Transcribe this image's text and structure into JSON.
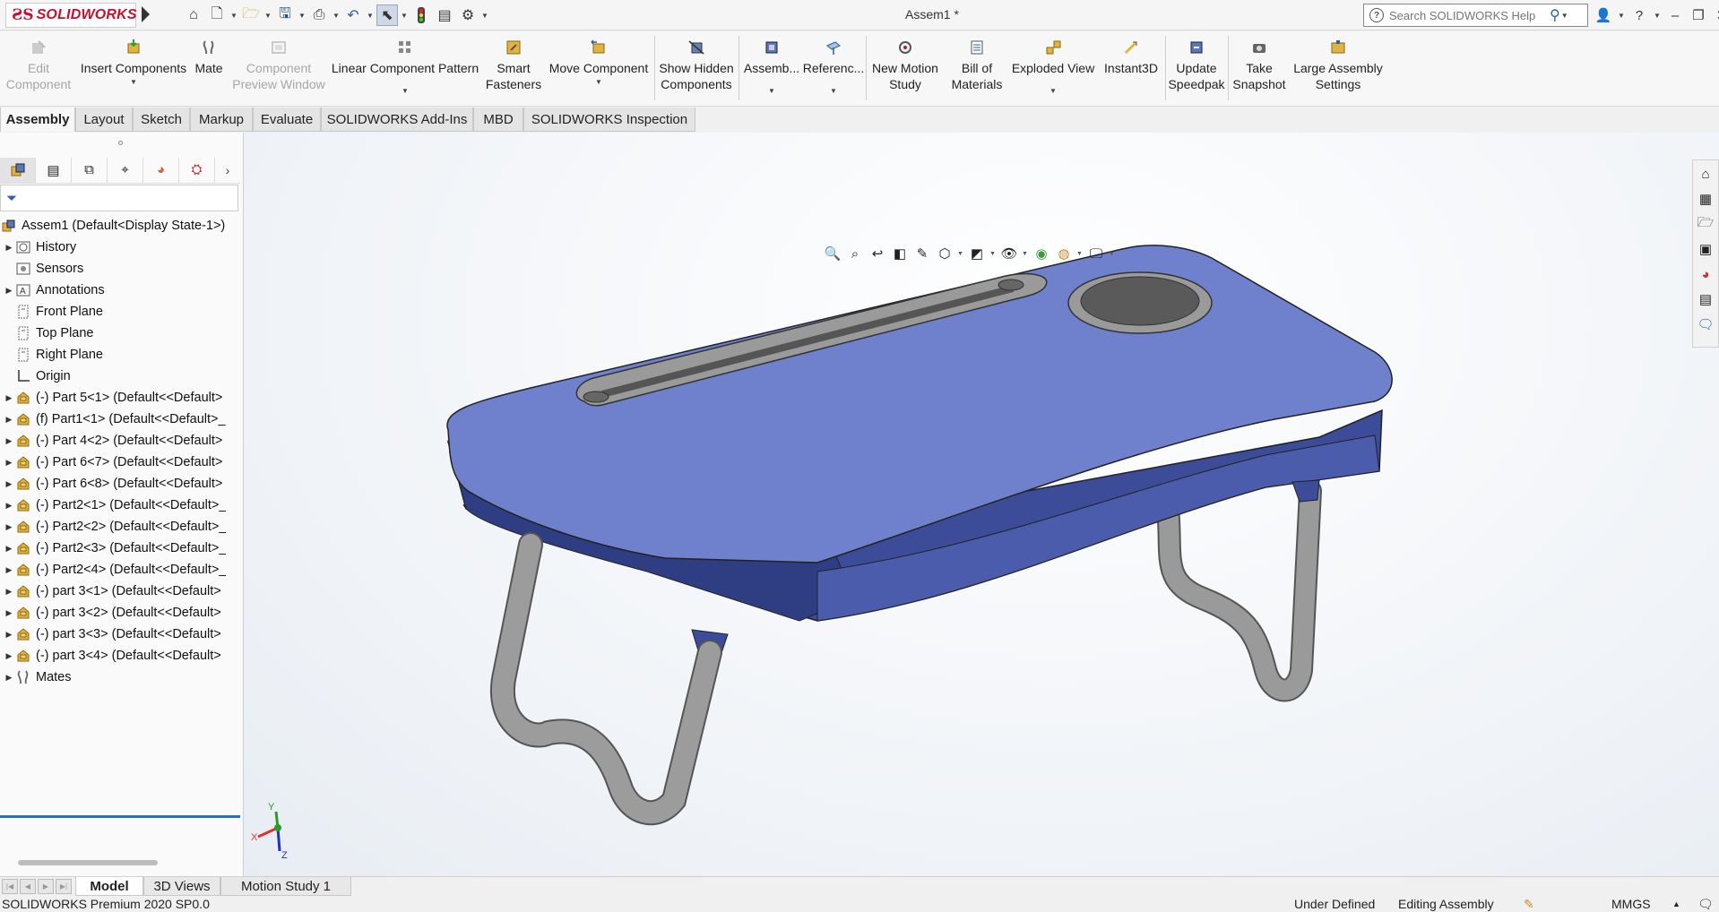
{
  "titlebar": {
    "app_logo_text": "SOLIDWORKS",
    "document_title": "Assem1 *",
    "search_placeholder": "Search SOLIDWORKS Help"
  },
  "commands": [
    {
      "label_1": "Edit",
      "label_2": "Component",
      "enabled": false,
      "icon": "edit-component-icon"
    },
    {
      "label_1": "Insert Components",
      "label_2": "",
      "enabled": true,
      "dropdown": true,
      "icon": "insert-components-icon"
    },
    {
      "label_1": "Mate",
      "label_2": "",
      "enabled": true,
      "icon": "mate-icon"
    },
    {
      "label_1": "Component",
      "label_2": "Preview Window",
      "enabled": false,
      "icon": "preview-window-icon"
    },
    {
      "label_1": "Linear Component Pattern",
      "label_2": "",
      "enabled": true,
      "dropdown": true,
      "icon": "linear-pattern-icon"
    },
    {
      "label_1": "Smart",
      "label_2": "Fasteners",
      "enabled": true,
      "icon": "smart-fasteners-icon"
    },
    {
      "label_1": "Move Component",
      "label_2": "",
      "enabled": true,
      "dropdown": true,
      "icon": "move-component-icon"
    },
    {
      "label_1": "Show Hidden",
      "label_2": "Components",
      "enabled": true,
      "icon": "show-hidden-icon"
    },
    {
      "label_1": "Assemb...",
      "label_2": "",
      "enabled": true,
      "dropdown": true,
      "icon": "assembly-features-icon"
    },
    {
      "label_1": "Referenc...",
      "label_2": "",
      "enabled": true,
      "dropdown": true,
      "icon": "reference-geometry-icon"
    },
    {
      "label_1": "New Motion",
      "label_2": "Study",
      "enabled": true,
      "icon": "motion-study-icon"
    },
    {
      "label_1": "Bill of",
      "label_2": "Materials",
      "enabled": true,
      "icon": "bom-icon"
    },
    {
      "label_1": "Exploded View",
      "label_2": "",
      "enabled": true,
      "dropdown": true,
      "icon": "exploded-view-icon"
    },
    {
      "label_1": "Instant3D",
      "label_2": "",
      "enabled": true,
      "icon": "instant3d-icon"
    },
    {
      "label_1": "Update",
      "label_2": "Speedpak",
      "enabled": true,
      "icon": "speedpak-icon"
    },
    {
      "label_1": "Take",
      "label_2": "Snapshot",
      "enabled": true,
      "icon": "snapshot-icon"
    },
    {
      "label_1": "Large Assembly",
      "label_2": "Settings",
      "enabled": true,
      "icon": "large-assembly-icon"
    }
  ],
  "tabs": [
    "Assembly",
    "Layout",
    "Sketch",
    "Markup",
    "Evaluate",
    "SOLIDWORKS Add-Ins",
    "MBD",
    "SOLIDWORKS Inspection"
  ],
  "active_tab": "Assembly",
  "tree": {
    "root": "Assem1  (Default<Display State-1>)",
    "items": [
      {
        "label": "History",
        "expandable": true,
        "icon": "history-icon"
      },
      {
        "label": "Sensors",
        "expandable": false,
        "icon": "sensors-icon"
      },
      {
        "label": "Annotations",
        "expandable": true,
        "icon": "annotations-icon"
      },
      {
        "label": "Front Plane",
        "expandable": false,
        "icon": "plane-icon"
      },
      {
        "label": "Top Plane",
        "expandable": false,
        "icon": "plane-icon"
      },
      {
        "label": "Right Plane",
        "expandable": false,
        "icon": "plane-icon"
      },
      {
        "label": "Origin",
        "expandable": false,
        "icon": "origin-icon"
      },
      {
        "label": "(-) Part 5<1> (Default<<Default>",
        "expandable": true,
        "icon": "part-icon"
      },
      {
        "label": "(f) Part1<1> (Default<<Default>_",
        "expandable": true,
        "icon": "part-icon"
      },
      {
        "label": "(-) Part 4<2> (Default<<Default>",
        "expandable": true,
        "icon": "part-icon"
      },
      {
        "label": "(-) Part 6<7> (Default<<Default>",
        "expandable": true,
        "icon": "part-icon"
      },
      {
        "label": "(-) Part 6<8> (Default<<Default>",
        "expandable": true,
        "icon": "part-icon"
      },
      {
        "label": "(-) Part2<1> (Default<<Default>_",
        "expandable": true,
        "icon": "part-icon"
      },
      {
        "label": "(-) Part2<2> (Default<<Default>_",
        "expandable": true,
        "icon": "part-icon"
      },
      {
        "label": "(-) Part2<3> (Default<<Default>_",
        "expandable": true,
        "icon": "part-icon"
      },
      {
        "label": "(-) Part2<4> (Default<<Default>_",
        "expandable": true,
        "icon": "part-icon"
      },
      {
        "label": "(-) part 3<1> (Default<<Default>",
        "expandable": true,
        "icon": "part-icon"
      },
      {
        "label": "(-) part 3<2> (Default<<Default>",
        "expandable": true,
        "icon": "part-icon"
      },
      {
        "label": "(-) part 3<3> (Default<<Default>",
        "expandable": true,
        "icon": "part-icon"
      },
      {
        "label": "(-) part 3<4> (Default<<Default>",
        "expandable": true,
        "icon": "part-icon"
      },
      {
        "label": "Mates",
        "expandable": true,
        "icon": "mates-icon"
      }
    ]
  },
  "triad": {
    "x": "X",
    "y": "Y",
    "z": "Z"
  },
  "bottom_tabs": [
    "Model",
    "3D Views",
    "Motion Study 1"
  ],
  "active_bottom_tab": "Model",
  "status": {
    "product": "SOLIDWORKS Premium 2020 SP0.0",
    "definition": "Under Defined",
    "mode": "Editing Assembly",
    "units": "MMGS"
  },
  "colors": {
    "brand": "#c8102e",
    "table_top": "#6f80cc",
    "table_edge": "#3c4c98",
    "legs": "#8c8c8c",
    "tree_accent": "#2d6eb8"
  }
}
